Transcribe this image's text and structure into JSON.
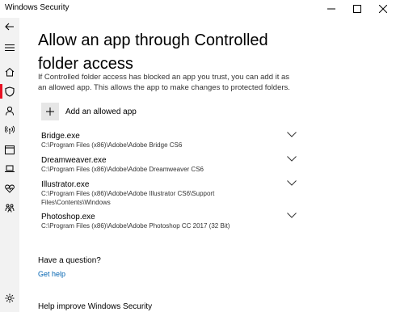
{
  "window": {
    "title": "Windows Security",
    "controls": [
      "minimize-icon",
      "maximize-icon",
      "close-icon"
    ]
  },
  "nav": {
    "back_icon": "back-arrow-icon",
    "menu_icon": "hamburger-menu-icon",
    "items": [
      {
        "icon": "home-icon"
      },
      {
        "icon": "shield-icon",
        "active": true
      },
      {
        "icon": "person-icon"
      },
      {
        "icon": "wifi-antenna-icon"
      },
      {
        "icon": "app-browser-icon"
      },
      {
        "icon": "laptop-icon"
      },
      {
        "icon": "heart-icon"
      },
      {
        "icon": "family-icon"
      }
    ],
    "settings_icon": "gear-icon",
    "accent_color": "#e81123"
  },
  "main": {
    "title": "Allow an app through Controlled folder access",
    "description": "If Controlled folder access has blocked an app you trust, you can add it as an allowed app. This allows the app to make changes to protected folders.",
    "add_button": {
      "label": "Add an allowed app",
      "icon": "plus-icon"
    },
    "apps": [
      {
        "name": "Bridge.exe",
        "path": "C:\\Program Files (x86)\\Adobe\\Adobe Bridge CS6"
      },
      {
        "name": "Dreamweaver.exe",
        "path": "C:\\Program Files (x86)\\Adobe\\Adobe Dreamweaver CS6"
      },
      {
        "name": "Illustrator.exe",
        "path": "C:\\Program Files (x86)\\Adobe\\Adobe Illustrator CS6\\Support Files\\Contents\\Windows"
      },
      {
        "name": "Photoshop.exe",
        "path": "C:\\Program Files (x86)\\Adobe\\Adobe Photoshop CC 2017 (32 Bit)"
      }
    ],
    "question_heading": "Have a question?",
    "help_link": "Get help",
    "improve_heading": "Help improve Windows Security",
    "link_color": "#0063b1"
  }
}
